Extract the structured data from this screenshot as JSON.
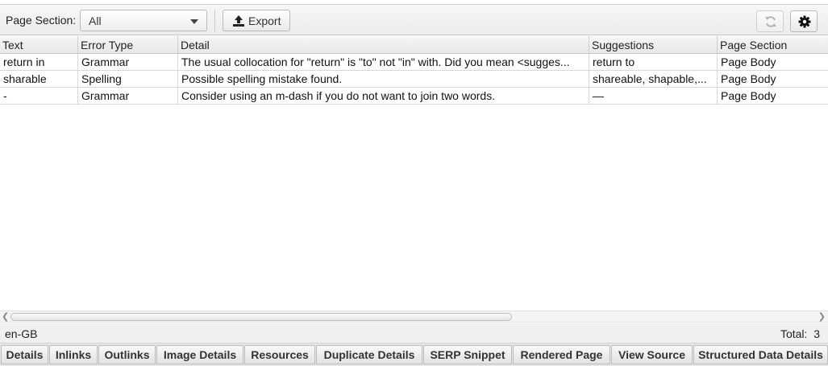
{
  "toolbar": {
    "page_section_label": "Page Section:",
    "page_section_value": "All",
    "export_label": "Export",
    "icons": {
      "export": "upload-icon",
      "refresh": "refresh-icon",
      "settings": "gear-icon"
    }
  },
  "table": {
    "columns": [
      "Text",
      "Error Type",
      "Detail",
      "Suggestions",
      "Page Section"
    ],
    "rows": [
      {
        "text": "return in",
        "error_type": "Grammar",
        "detail": "The usual collocation for \"return\" is \"to\" not \"in\" with. Did you mean <sugges...",
        "suggestions": "return to",
        "page_section": "Page Body"
      },
      {
        "text": "sharable",
        "error_type": "Spelling",
        "detail": "Possible spelling mistake found.",
        "suggestions": "shareable, shapable,...",
        "page_section": "Page Body"
      },
      {
        "text": "-",
        "error_type": "Grammar",
        "detail": "Consider using an m-dash if you do not want to join two words.",
        "suggestions": "—",
        "page_section": "Page Body"
      }
    ]
  },
  "status": {
    "language": "en-GB",
    "total_label": "Total:",
    "total_value": "3"
  },
  "tabs": [
    "Details",
    "Inlinks",
    "Outlinks",
    "Image Details",
    "Resources",
    "Duplicate Details",
    "SERP Snippet",
    "Rendered Page",
    "View Source",
    "Structured Data Details"
  ]
}
